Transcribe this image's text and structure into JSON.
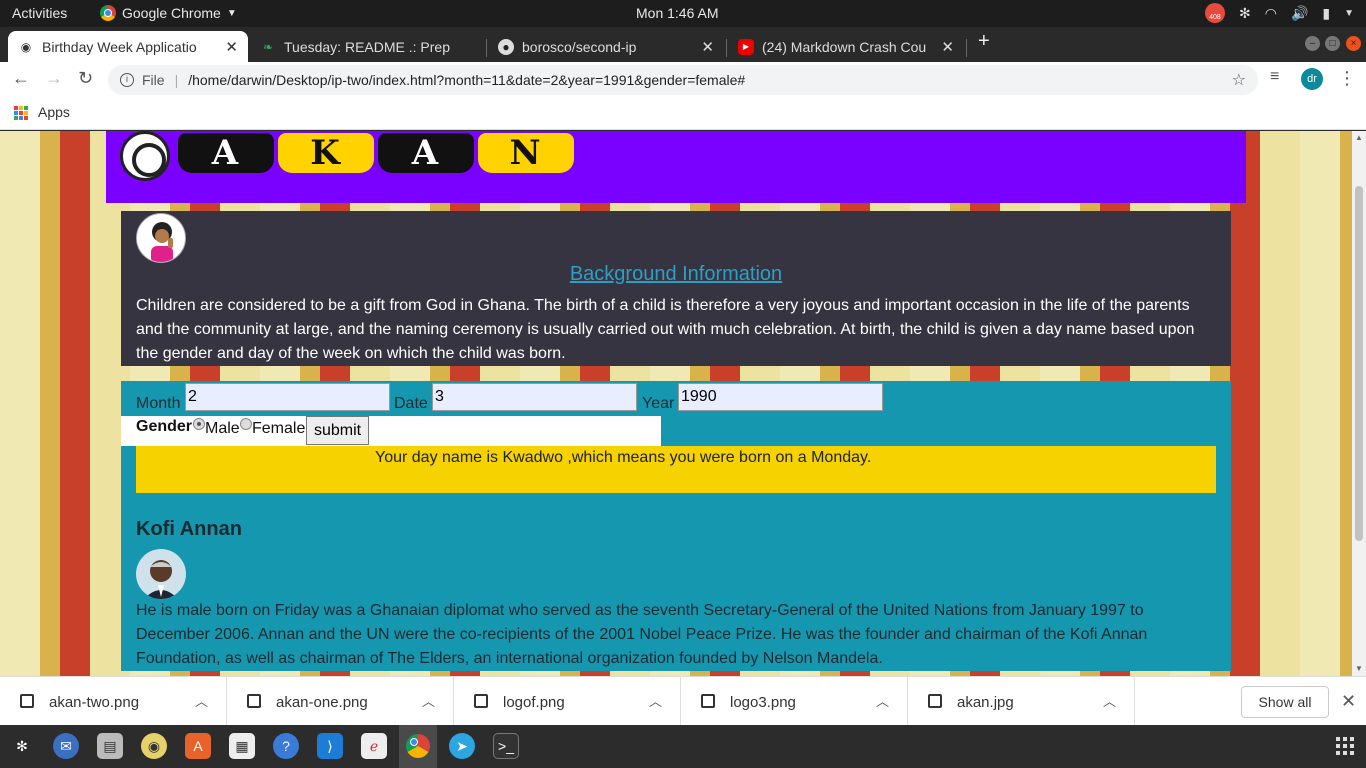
{
  "system_bar": {
    "activities": "Activities",
    "app_name": "Google Chrome",
    "clock": "Mon  1:46 AM",
    "notification_count": "408"
  },
  "tabs": [
    {
      "title": "Birthday Week Applicatio",
      "icon": "globe-icon"
    },
    {
      "title": "Tuesday: README .: Prep",
      "icon": "leaf-icon"
    },
    {
      "title": "borosco/second-ip",
      "icon": "github-icon"
    },
    {
      "title": "(24) Markdown Crash Cou",
      "icon": "youtube-icon"
    }
  ],
  "toolbar": {
    "file_label": "File",
    "url": "/home/darwin/Desktop/ip-two/index.html?month=11&date=2&year=1991&gender=female#",
    "profile_initials": "dr"
  },
  "bookmarks": {
    "apps_label": "Apps"
  },
  "page": {
    "logo_letters": [
      "A",
      "K",
      "A",
      "N"
    ],
    "background": {
      "heading": "Background Information",
      "text": "Children are considered to be a gift from God in Ghana. The birth of a child is therefore a very joyous and important occasion in the life of the parents and the community at large, and the naming ceremony is usually carried out with much celebration. At birth, the child is given a day name based upon the gender and day of the week on which the child was born."
    },
    "form": {
      "month_label": "Month",
      "month_value": "2",
      "date_label": "Date",
      "date_value": "3",
      "year_label": "Year",
      "year_value": "1990",
      "gender_label": "Gender",
      "male_label": "Male",
      "female_label": "Female",
      "selected_gender": "male",
      "submit_label": "submit"
    },
    "result": "Your day name is Kwadwo ,which means you were born on a Monday.",
    "person": {
      "name": "Kofi Annan",
      "bio": "He is male born on Friday was a Ghanaian diplomat who served as the seventh Secretary-General of the United Nations from January 1997 to December 2006. Annan and the UN were the co-recipients of the 2001 Nobel Peace Prize. He was the founder and chairman of the Kofi Annan Foundation, as well as chairman of The Elders, an international organization founded by Nelson Mandela."
    }
  },
  "downloads": {
    "files": [
      "akan-two.png",
      "akan-one.png",
      "logof.png",
      "logo3.png",
      "akan.jpg"
    ],
    "show_all": "Show all"
  },
  "colors": {
    "header_purple": "#7a00ff",
    "panel_dark": "#363440",
    "form_teal": "#1597af",
    "result_yellow": "#f5d200",
    "link_blue": "#2aa0c7"
  }
}
